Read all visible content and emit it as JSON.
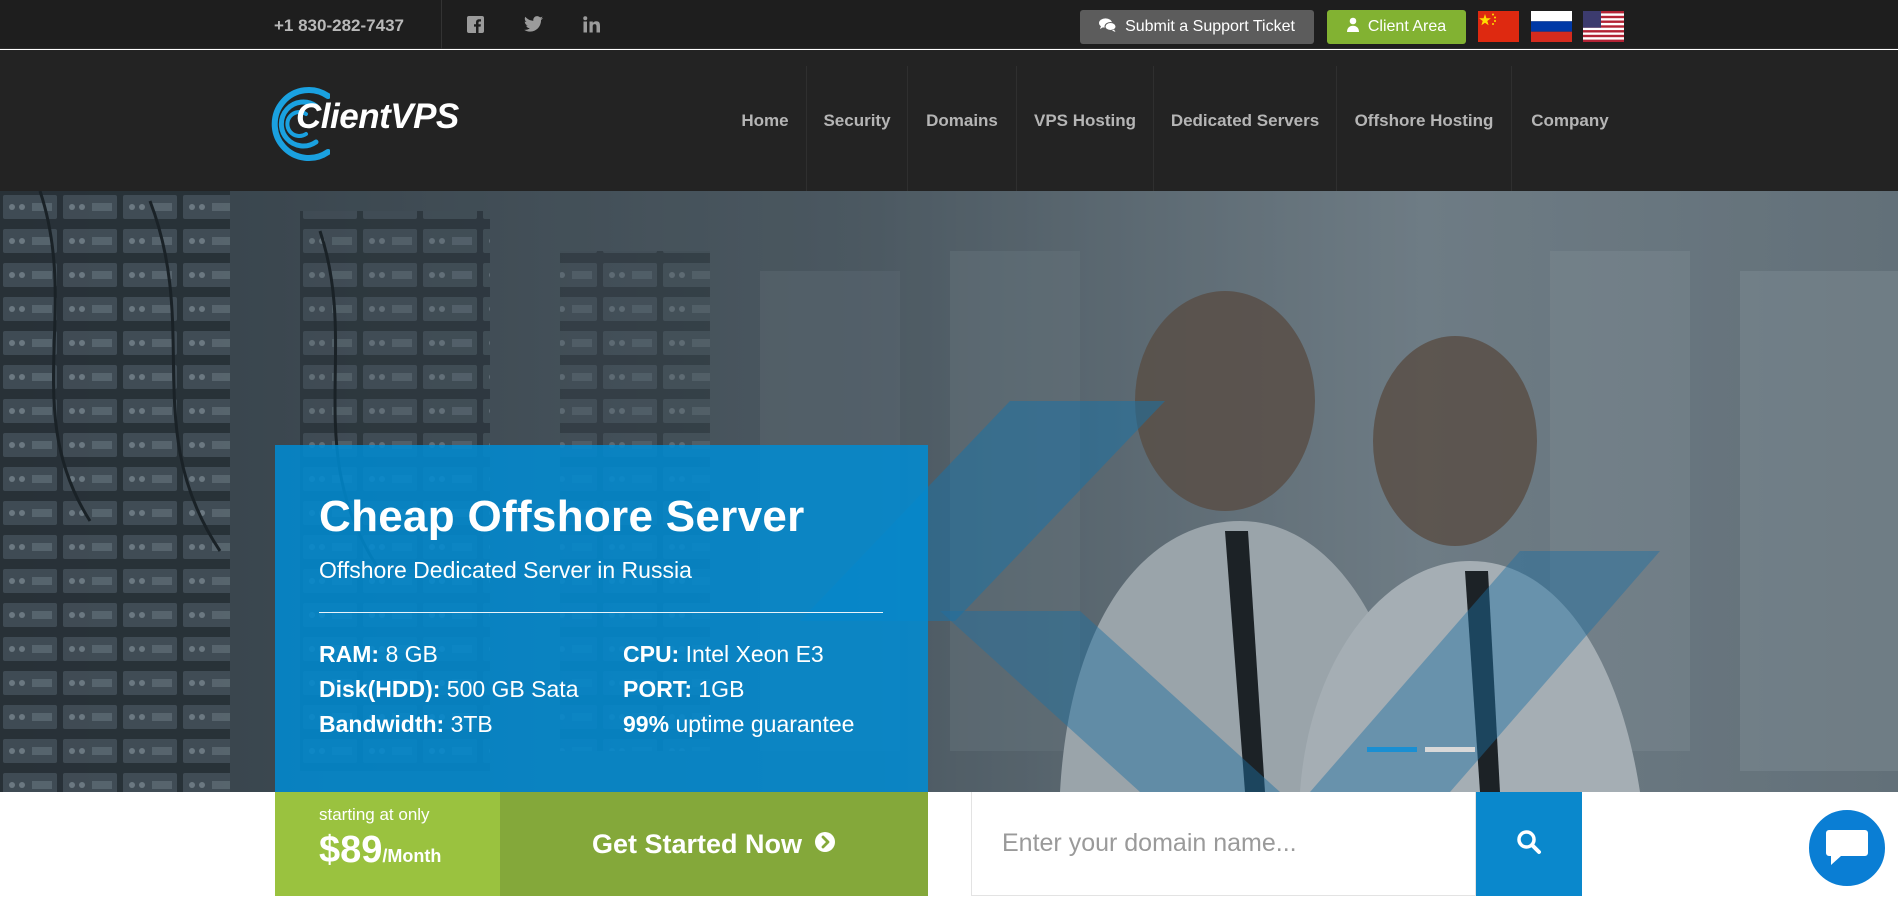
{
  "topbar": {
    "phone": "+1 830-282-7437",
    "social": [
      "facebook-icon",
      "twitter-icon",
      "linkedin-icon"
    ],
    "ticket_label": "Submit a Support Ticket",
    "client_label": "Client Area",
    "flags": [
      "china-flag",
      "russia-flag",
      "usa-flag"
    ]
  },
  "brand": {
    "name": "ClientVPS",
    "accent": "#1aa1e0"
  },
  "nav": [
    "Home",
    "Security",
    "Domains",
    "VPS Hosting",
    "Dedicated Servers",
    "Offshore Hosting",
    "Company"
  ],
  "hero": {
    "title": "Cheap Offshore Server",
    "subtitle": "Offshore Dedicated Server in Russia",
    "specs_left": [
      {
        "label": "RAM:",
        "value": "8 GB"
      },
      {
        "label": "Disk(HDD):",
        "value": "500 GB Sata"
      },
      {
        "label": "Bandwidth:",
        "value": "3TB"
      }
    ],
    "specs_right": [
      {
        "label": "CPU:",
        "value": "Intel Xeon E3"
      },
      {
        "label": "PORT:",
        "value": "1GB"
      },
      {
        "label": "99%",
        "value": "uptime guarantee"
      }
    ],
    "slide_count": 2,
    "active_slide": 1
  },
  "pricing": {
    "starting_text": "starting at only",
    "price": "$89",
    "period": "/Month",
    "cta_label": "Get Started Now"
  },
  "domain_search": {
    "placeholder": "Enter your domain name..."
  },
  "colors": {
    "topbar_bg": "#1e1e1e",
    "nav_bg": "#232323",
    "promo_blue": "#008cd4",
    "green": "#9ac23f",
    "green_dark": "#84a83a",
    "search_blue": "#0a88cc"
  }
}
